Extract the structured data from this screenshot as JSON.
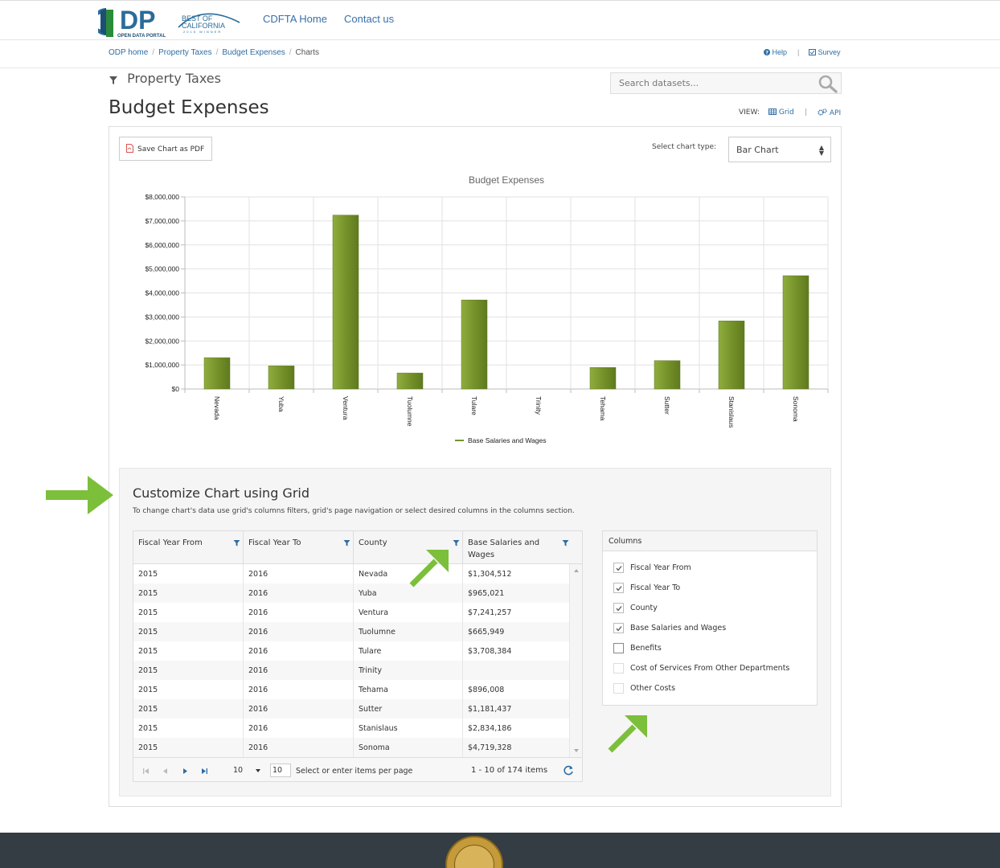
{
  "header": {
    "logo_text": "DP",
    "logo_sub": "OPEN DATA PORTAL",
    "award_line1": "BEST OF",
    "award_line2": "CALIFORNIA",
    "award_line3": "2015 WINNER",
    "nav": [
      "CDFTA Home",
      "Contact us"
    ]
  },
  "breadcrumb": {
    "items": [
      "ODP home",
      "Property Taxes",
      "Budget Expenses"
    ],
    "current": "Charts",
    "help": "Help",
    "survey": "Survey"
  },
  "category": "Property Taxes",
  "search": {
    "placeholder": "Search datasets..."
  },
  "page_title": "Budget Expenses",
  "view": {
    "label": "VIEW:",
    "grid": "Grid",
    "api": "API"
  },
  "toolbar": {
    "pdf_label": "Save Chart as PDF",
    "type_label": "Select chart type:",
    "type_value": "Bar Chart"
  },
  "chart_data": {
    "type": "bar",
    "title": "Budget Expenses",
    "categories": [
      "Nevada",
      "Yuba",
      "Ventura",
      "Tuolumne",
      "Tulare",
      "Trinity",
      "Tehama",
      "Sutter",
      "Stanislaus",
      "Sonoma"
    ],
    "series": [
      {
        "name": "Base Salaries and Wages",
        "values": [
          1304512,
          965021,
          7241257,
          665949,
          3708384,
          null,
          896008,
          1181437,
          2834186,
          4719328
        ]
      }
    ],
    "yticks": [
      "$0",
      "$1,000,000",
      "$2,000,000",
      "$3,000,000",
      "$4,000,000",
      "$5,000,000",
      "$6,000,000",
      "$7,000,000",
      "$8,000,000"
    ],
    "ylim": [
      0,
      8000000
    ],
    "grid": true,
    "legend": "bottom-center",
    "color": "#76922a"
  },
  "customize": {
    "title": "Customize Chart using Grid",
    "subtitle": "To change chart's data use grid's columns filters, grid's page navigation or select desired columns in the columns section."
  },
  "grid": {
    "headers": [
      "Fiscal Year From",
      "Fiscal Year To",
      "County",
      "Base Salaries and Wages"
    ],
    "rows": [
      [
        "2015",
        "2016",
        "Nevada",
        "$1,304,512"
      ],
      [
        "2015",
        "2016",
        "Yuba",
        "$965,021"
      ],
      [
        "2015",
        "2016",
        "Ventura",
        "$7,241,257"
      ],
      [
        "2015",
        "2016",
        "Tuolumne",
        "$665,949"
      ],
      [
        "2015",
        "2016",
        "Tulare",
        "$3,708,384"
      ],
      [
        "2015",
        "2016",
        "Trinity",
        ""
      ],
      [
        "2015",
        "2016",
        "Tehama",
        "$896,008"
      ],
      [
        "2015",
        "2016",
        "Sutter",
        "$1,181,437"
      ],
      [
        "2015",
        "2016",
        "Stanislaus",
        "$2,834,186"
      ],
      [
        "2015",
        "2016",
        "Sonoma",
        "$4,719,328"
      ]
    ],
    "pager": {
      "page_size": "10",
      "page_input": "10",
      "label": "Select or enter items per page",
      "info": "1 - 10 of 174 items"
    }
  },
  "columns": {
    "title": "Columns",
    "items": [
      {
        "label": "Fiscal Year From",
        "checked": true
      },
      {
        "label": "Fiscal Year To",
        "checked": true
      },
      {
        "label": "County",
        "checked": true
      },
      {
        "label": "Base Salaries and Wages",
        "checked": true
      },
      {
        "label": "Benefits",
        "checked": false
      },
      {
        "label": "Cost of Services From Other Departments",
        "checked": false
      },
      {
        "label": "Other Costs",
        "checked": false
      }
    ]
  },
  "colors": {
    "accent": "#2e6da4",
    "arrow": "#7cbf3a",
    "bar": "#76922a",
    "footer": "#343c44"
  }
}
